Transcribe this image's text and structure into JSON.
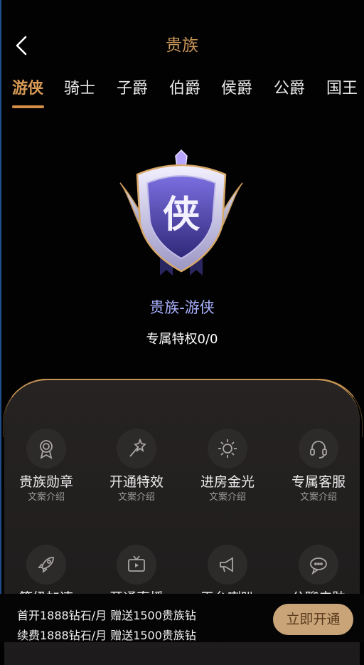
{
  "header": {
    "title": "贵族"
  },
  "tabs": [
    "游侠",
    "骑士",
    "子爵",
    "伯爵",
    "侯爵",
    "公爵",
    "国王"
  ],
  "badge": {
    "glyph": "侠",
    "rank_name": "贵族-游侠",
    "privilege_count": "专属特权0/0"
  },
  "perks": [
    {
      "title": "贵族勋章",
      "subtitle": "文案介绍",
      "icon": "medal-icon"
    },
    {
      "title": "开通特效",
      "subtitle": "文案介绍",
      "icon": "magic-wand-icon"
    },
    {
      "title": "进房金光",
      "subtitle": "文案介绍",
      "icon": "sun-icon"
    },
    {
      "title": "专属客服",
      "subtitle": "文案介绍",
      "icon": "headset-icon"
    },
    {
      "title": "等级加速",
      "icon": "rocket-icon"
    },
    {
      "title": "开通直播",
      "icon": "tv-icon"
    },
    {
      "title": "平台喇叭",
      "icon": "megaphone-icon"
    },
    {
      "title": "公聊皮肤",
      "icon": "chat-bubble-icon"
    }
  ],
  "bottom": {
    "line1": "首开1888钻石/月 赠送1500贵族钻",
    "line2": "续费1888钻石/月 赠送1500贵族钻",
    "button": "立即开通"
  },
  "colors": {
    "accent": "#d79a55",
    "rank_text": "#aab2ff",
    "button_bg": "#c9a478"
  }
}
